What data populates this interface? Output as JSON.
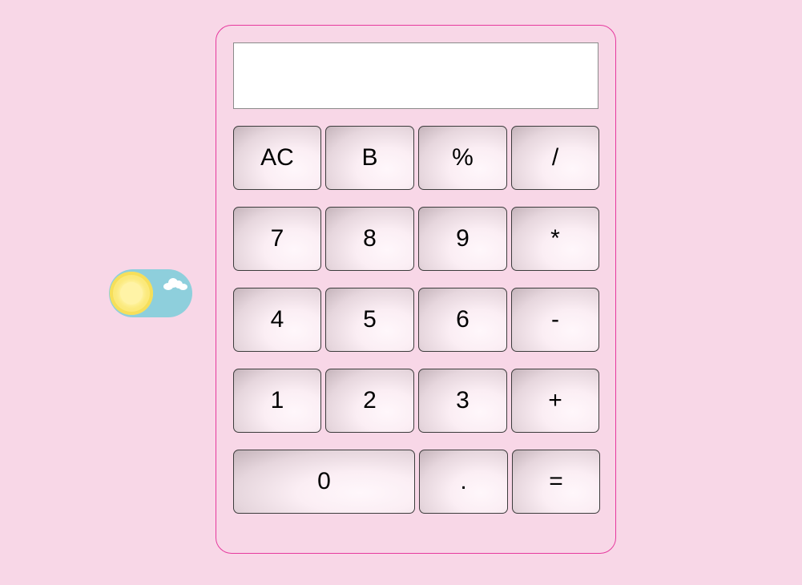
{
  "display": {
    "value": ""
  },
  "theme_toggle": {
    "sun_icon": "sun-icon",
    "cloud_icon": "cloud-icon",
    "accent": "#8ecfdc"
  },
  "calculator": {
    "border_color": "#e6399e",
    "keys": {
      "ac": "AC",
      "back": "B",
      "percent": "%",
      "divide": "/",
      "seven": "7",
      "eight": "8",
      "nine": "9",
      "multiply": "*",
      "four": "4",
      "five": "5",
      "six": "6",
      "minus": "-",
      "one": "1",
      "two": "2",
      "three": "3",
      "plus": "+",
      "zero": "0",
      "dot": ".",
      "equals": "="
    }
  }
}
